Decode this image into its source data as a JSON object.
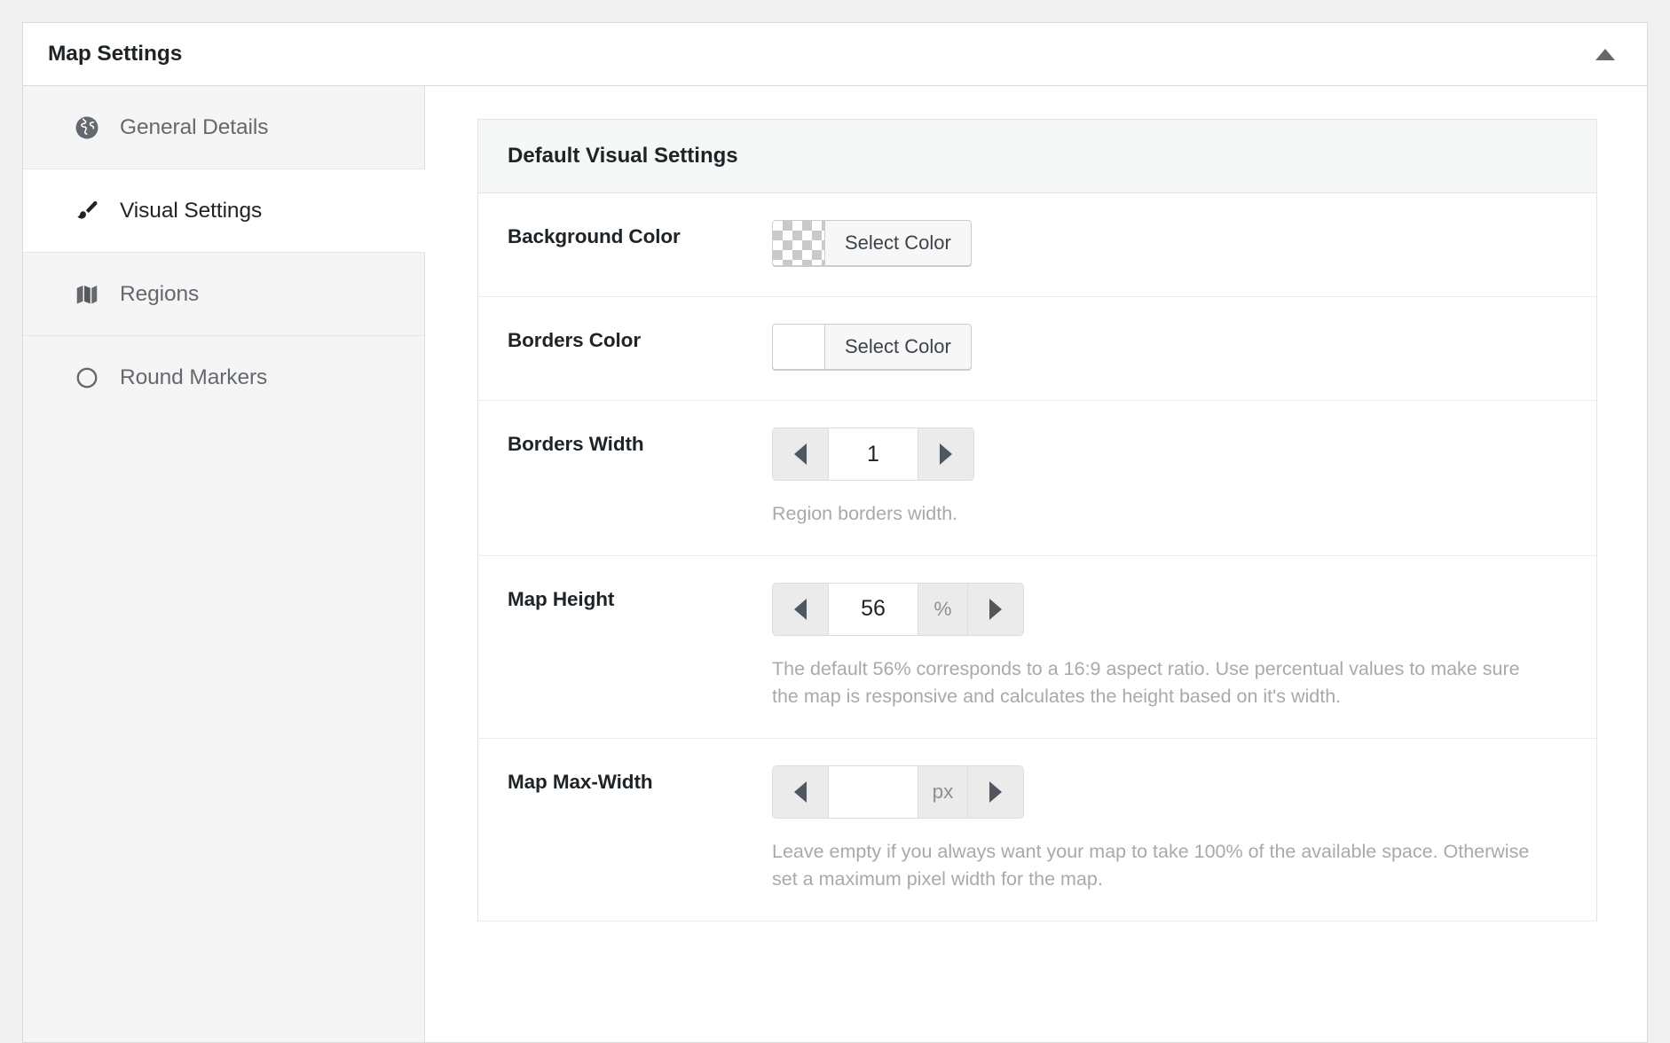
{
  "panel": {
    "title": "Map Settings",
    "collapse_icon": "triangle-up-icon"
  },
  "sidebar": {
    "items": [
      {
        "label": "General Details",
        "icon": "globe-icon",
        "active": false
      },
      {
        "label": "Visual Settings",
        "icon": "paintbrush-icon",
        "active": true
      },
      {
        "label": "Regions",
        "icon": "map-icon",
        "active": false
      },
      {
        "label": "Round Markers",
        "icon": "circle-icon",
        "active": false
      }
    ]
  },
  "main": {
    "card_title": "Default Visual Settings",
    "fields": {
      "background_color": {
        "label": "Background Color",
        "button_label": "Select Color",
        "swatch": "transparent"
      },
      "borders_color": {
        "label": "Borders Color",
        "button_label": "Select Color",
        "swatch": "#ffffff"
      },
      "borders_width": {
        "label": "Borders Width",
        "value": "1",
        "unit": "",
        "help": "Region borders width."
      },
      "map_height": {
        "label": "Map Height",
        "value": "56",
        "unit": "%",
        "help": "The default 56% corresponds to a 16:9 aspect ratio. Use percentual values to make sure the map is responsive and calculates the height based on it's width."
      },
      "map_max_width": {
        "label": "Map Max-Width",
        "value": "",
        "unit": "px",
        "help": "Leave empty if you always want your map to take 100% of the available space. Otherwise set a maximum pixel width for the map."
      }
    }
  },
  "colors": {
    "page_bg": "#f0f0f1",
    "panel_bg": "#ffffff",
    "sidebar_bg": "#f5f5f5",
    "border": "#dcdcde",
    "text_dark": "#1d2327",
    "text_muted": "#646970",
    "help_text": "#a7aaad"
  }
}
